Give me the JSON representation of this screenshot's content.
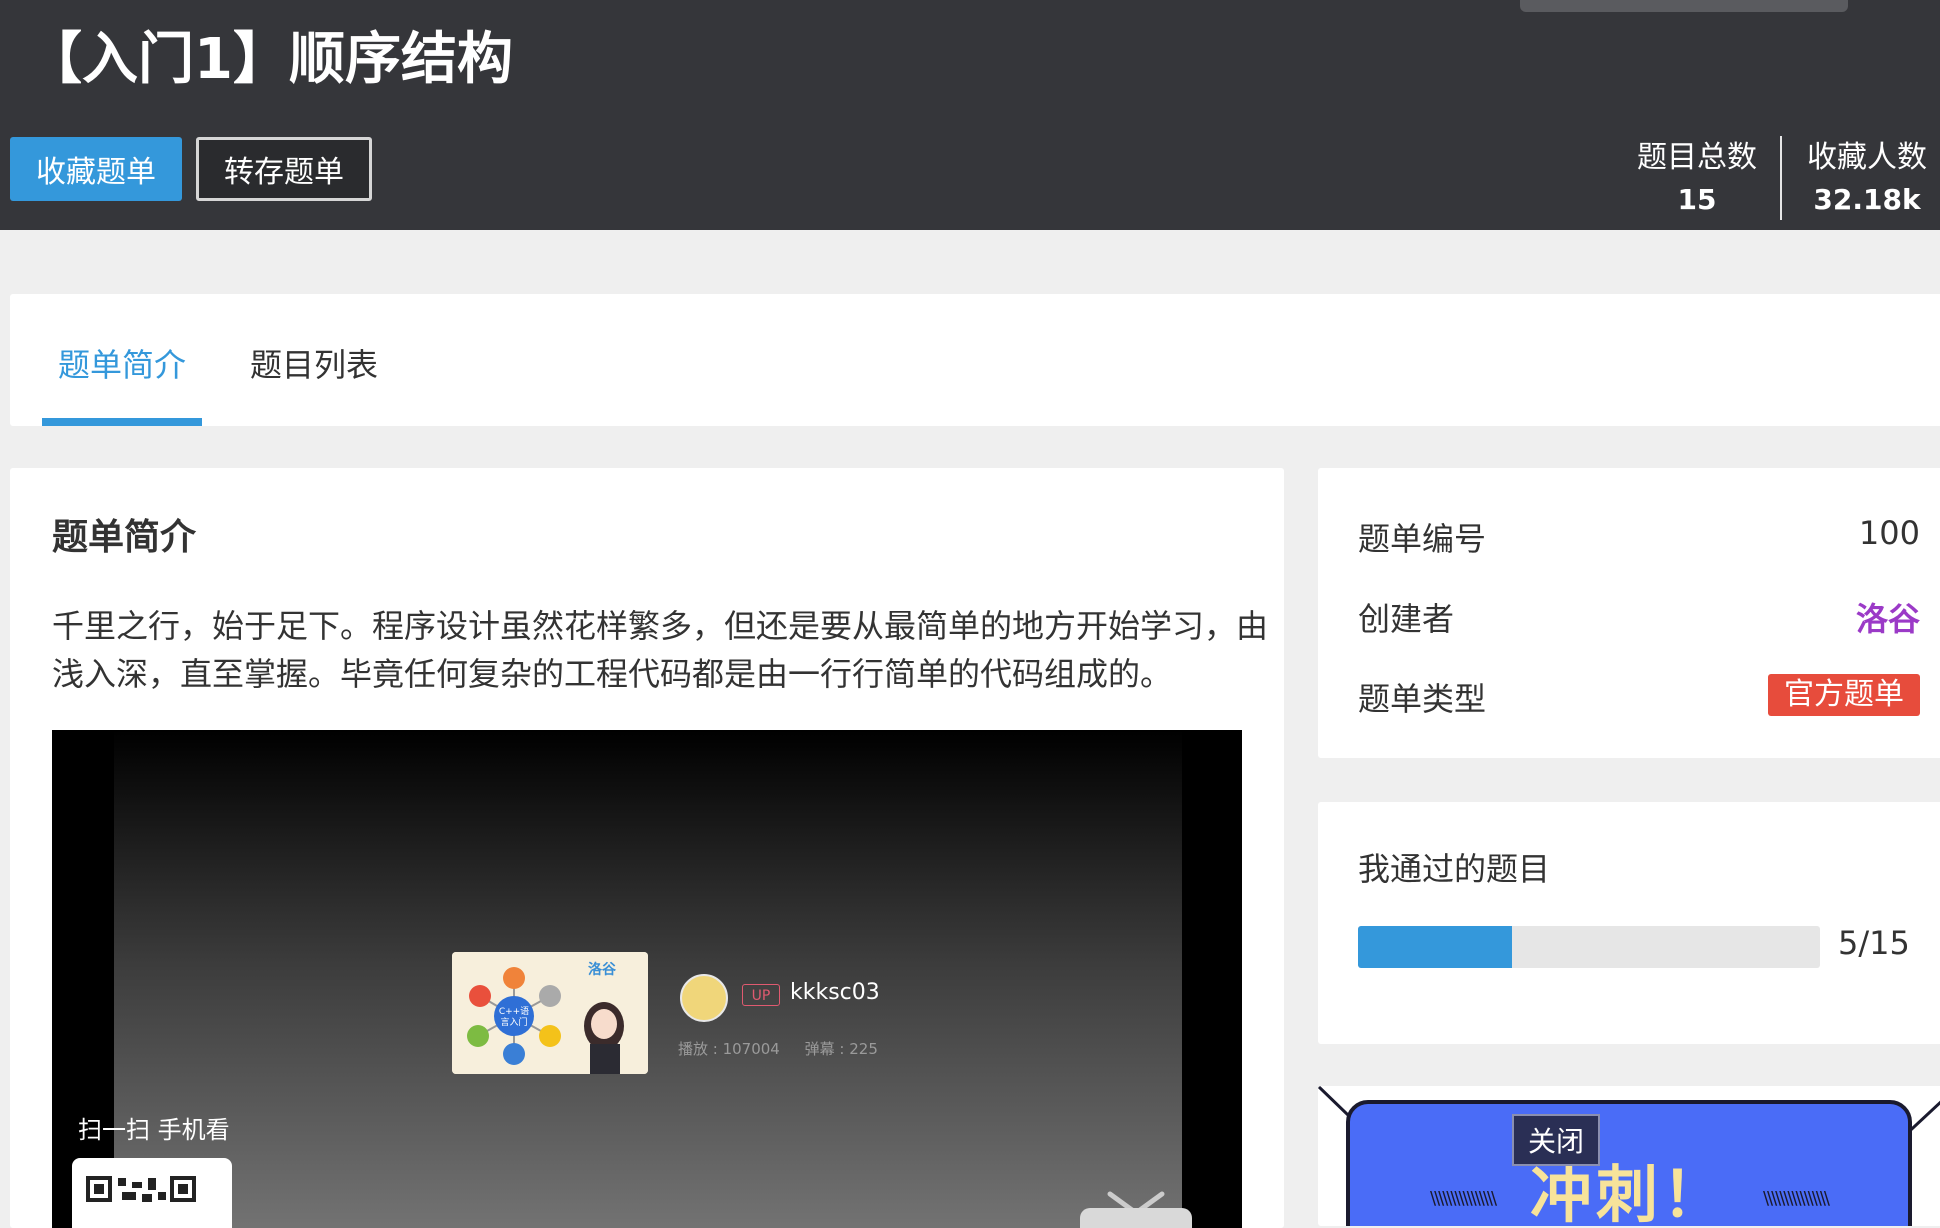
{
  "header": {
    "title": "【入门1】顺序结构",
    "favorite_label": "收藏题单",
    "save_label": "转存题单",
    "stats": [
      {
        "label": "题目总数",
        "value": "15"
      },
      {
        "label": "收藏人数",
        "value": "32.18k"
      }
    ]
  },
  "tabs": [
    {
      "label": "题单简介",
      "active": true
    },
    {
      "label": "题目列表",
      "active": false
    }
  ],
  "intro": {
    "title": "题单简介",
    "text": "千里之行，始于足下。程序设计虽然花样繁多，但还是要从最简单的地方开始学习，由浅入深，直至掌握。毕竟任何复杂的工程代码都是由一行行简单的代码组成的。"
  },
  "video": {
    "uploader_badge": "UP",
    "uploader": "kkksc03",
    "plays": "播放 : 107004",
    "danmaku": "弹幕 : 225",
    "scan_text": "扫一扫 手机看",
    "thumb_brand": "洛谷",
    "thumb_center": "C++语言入门"
  },
  "info": {
    "rows": [
      {
        "key": "题单编号",
        "value": "100"
      },
      {
        "key": "创建者",
        "value": "洛谷"
      },
      {
        "key": "题单类型",
        "value": "官方题单"
      }
    ],
    "creator_color": "#9b3ac7",
    "type_color": "#e74c3c"
  },
  "progress": {
    "title": "我通过的题目",
    "passed": 5,
    "total": 15,
    "label": "5/15"
  },
  "promo": {
    "text": "冲刺！",
    "close_label": "关闭"
  },
  "colors": {
    "accent": "#3498db",
    "header_bg": "#35363a"
  }
}
